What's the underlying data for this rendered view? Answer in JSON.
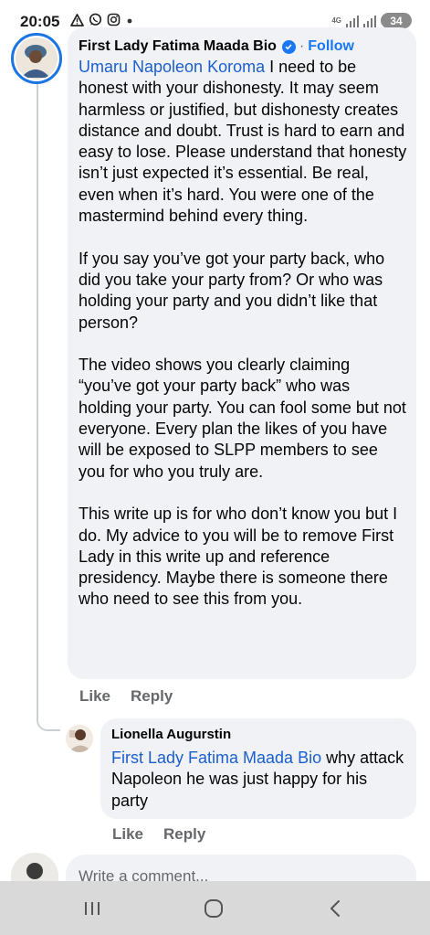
{
  "status_bar": {
    "time": "20:05",
    "network_label": "4G",
    "battery": "34"
  },
  "comment": {
    "author": "First Lady Fatima Maada Bio",
    "follow_label": "Follow",
    "separator": "·",
    "mention": "Umaru Napoleon Koroma",
    "paragraph_1": " I need to be honest with your dishonesty. It may seem harmless or justified, but dishonesty creates distance and doubt. Trust is hard to earn and easy to lose. Please understand that honesty isn’t just expected it’s essential. Be real, even when it’s hard. You were one of the mastermind behind every thing.",
    "paragraph_2": "If you say you’ve got your party back, who did you take your party from? Or who was holding your party and you didn’t like that person?",
    "paragraph_3": "The video shows you clearly claiming “you’ve got your party back” who was holding your party. You can fool some but not everyone. Every plan the likes of you have will be exposed to SLPP members to see you for who you truly are.",
    "paragraph_4": "This write up is for who don’t know you but I do. My advice to you will be to remove First Lady in this write up and reference presidency. Maybe there is someone there who need to see this from you.",
    "like_label": "Like",
    "reply_label": "Reply"
  },
  "reply": {
    "author": "Lionella Augurstin",
    "mention": "First Lady Fatima Maada Bio",
    "text": " why attack Napoleon he was just happy for his party",
    "like_label": "Like",
    "reply_label": "Reply"
  },
  "composer": {
    "placeholder": "Write a comment..."
  },
  "icons": {
    "alert": "alert-triangle-icon",
    "whatsapp": "whatsapp-icon",
    "instagram": "instagram-icon",
    "verified": "verified-badge-icon",
    "nav_recent": "recent-apps-icon",
    "nav_home": "home-icon",
    "nav_back": "back-icon"
  },
  "colors": {
    "link": "#1b5fcf",
    "facebook_blue": "#1877f2",
    "bubble": "#f0f2f5",
    "secondary_text": "#65676b",
    "navbar": "#d9d9d9"
  }
}
